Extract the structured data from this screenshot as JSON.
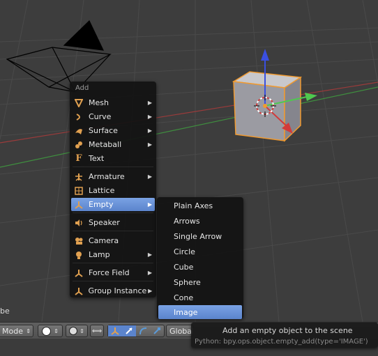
{
  "viewport": {
    "corner_label": "be"
  },
  "add_menu": {
    "title": "Add",
    "items": [
      {
        "label": "Mesh",
        "icon": "mesh-icon",
        "submenu": true
      },
      {
        "label": "Curve",
        "icon": "curve-icon",
        "submenu": true
      },
      {
        "label": "Surface",
        "icon": "surface-icon",
        "submenu": true
      },
      {
        "label": "Metaball",
        "icon": "metaball-icon",
        "submenu": true
      },
      {
        "label": "Text",
        "icon": "text-icon",
        "submenu": false
      },
      {
        "label": "Armature",
        "icon": "armature-icon",
        "submenu": true
      },
      {
        "label": "Lattice",
        "icon": "lattice-icon",
        "submenu": false
      },
      {
        "label": "Empty",
        "icon": "empty-icon",
        "submenu": true,
        "active": true
      },
      {
        "label": "Speaker",
        "icon": "speaker-icon",
        "submenu": false
      },
      {
        "label": "Camera",
        "icon": "camera-icon",
        "submenu": false
      },
      {
        "label": "Lamp",
        "icon": "lamp-icon",
        "submenu": true
      },
      {
        "label": "Force Field",
        "icon": "force-field-icon",
        "submenu": true
      },
      {
        "label": "Group Instance",
        "icon": "group-instance-icon",
        "submenu": true
      }
    ],
    "arrow_glyph": "▶"
  },
  "empty_submenu": {
    "items": [
      {
        "label": "Plain Axes"
      },
      {
        "label": "Arrows"
      },
      {
        "label": "Single Arrow"
      },
      {
        "label": "Circle"
      },
      {
        "label": "Cube"
      },
      {
        "label": "Sphere"
      },
      {
        "label": "Cone"
      },
      {
        "label": "Image",
        "active": true
      }
    ]
  },
  "tooltip": {
    "description": "Add an empty object to the scene",
    "python": "Python: bpy.ops.object.empty_add(type='IMAGE')"
  },
  "header": {
    "mode_label": "Mode",
    "orientation_label": "Global"
  },
  "colors": {
    "menu_highlight": "#6b93d6",
    "x_axis": "#d23a3a",
    "y_axis": "#4fc94f",
    "z_axis": "#3a4fe0",
    "selection_outline": "#f09a30"
  }
}
